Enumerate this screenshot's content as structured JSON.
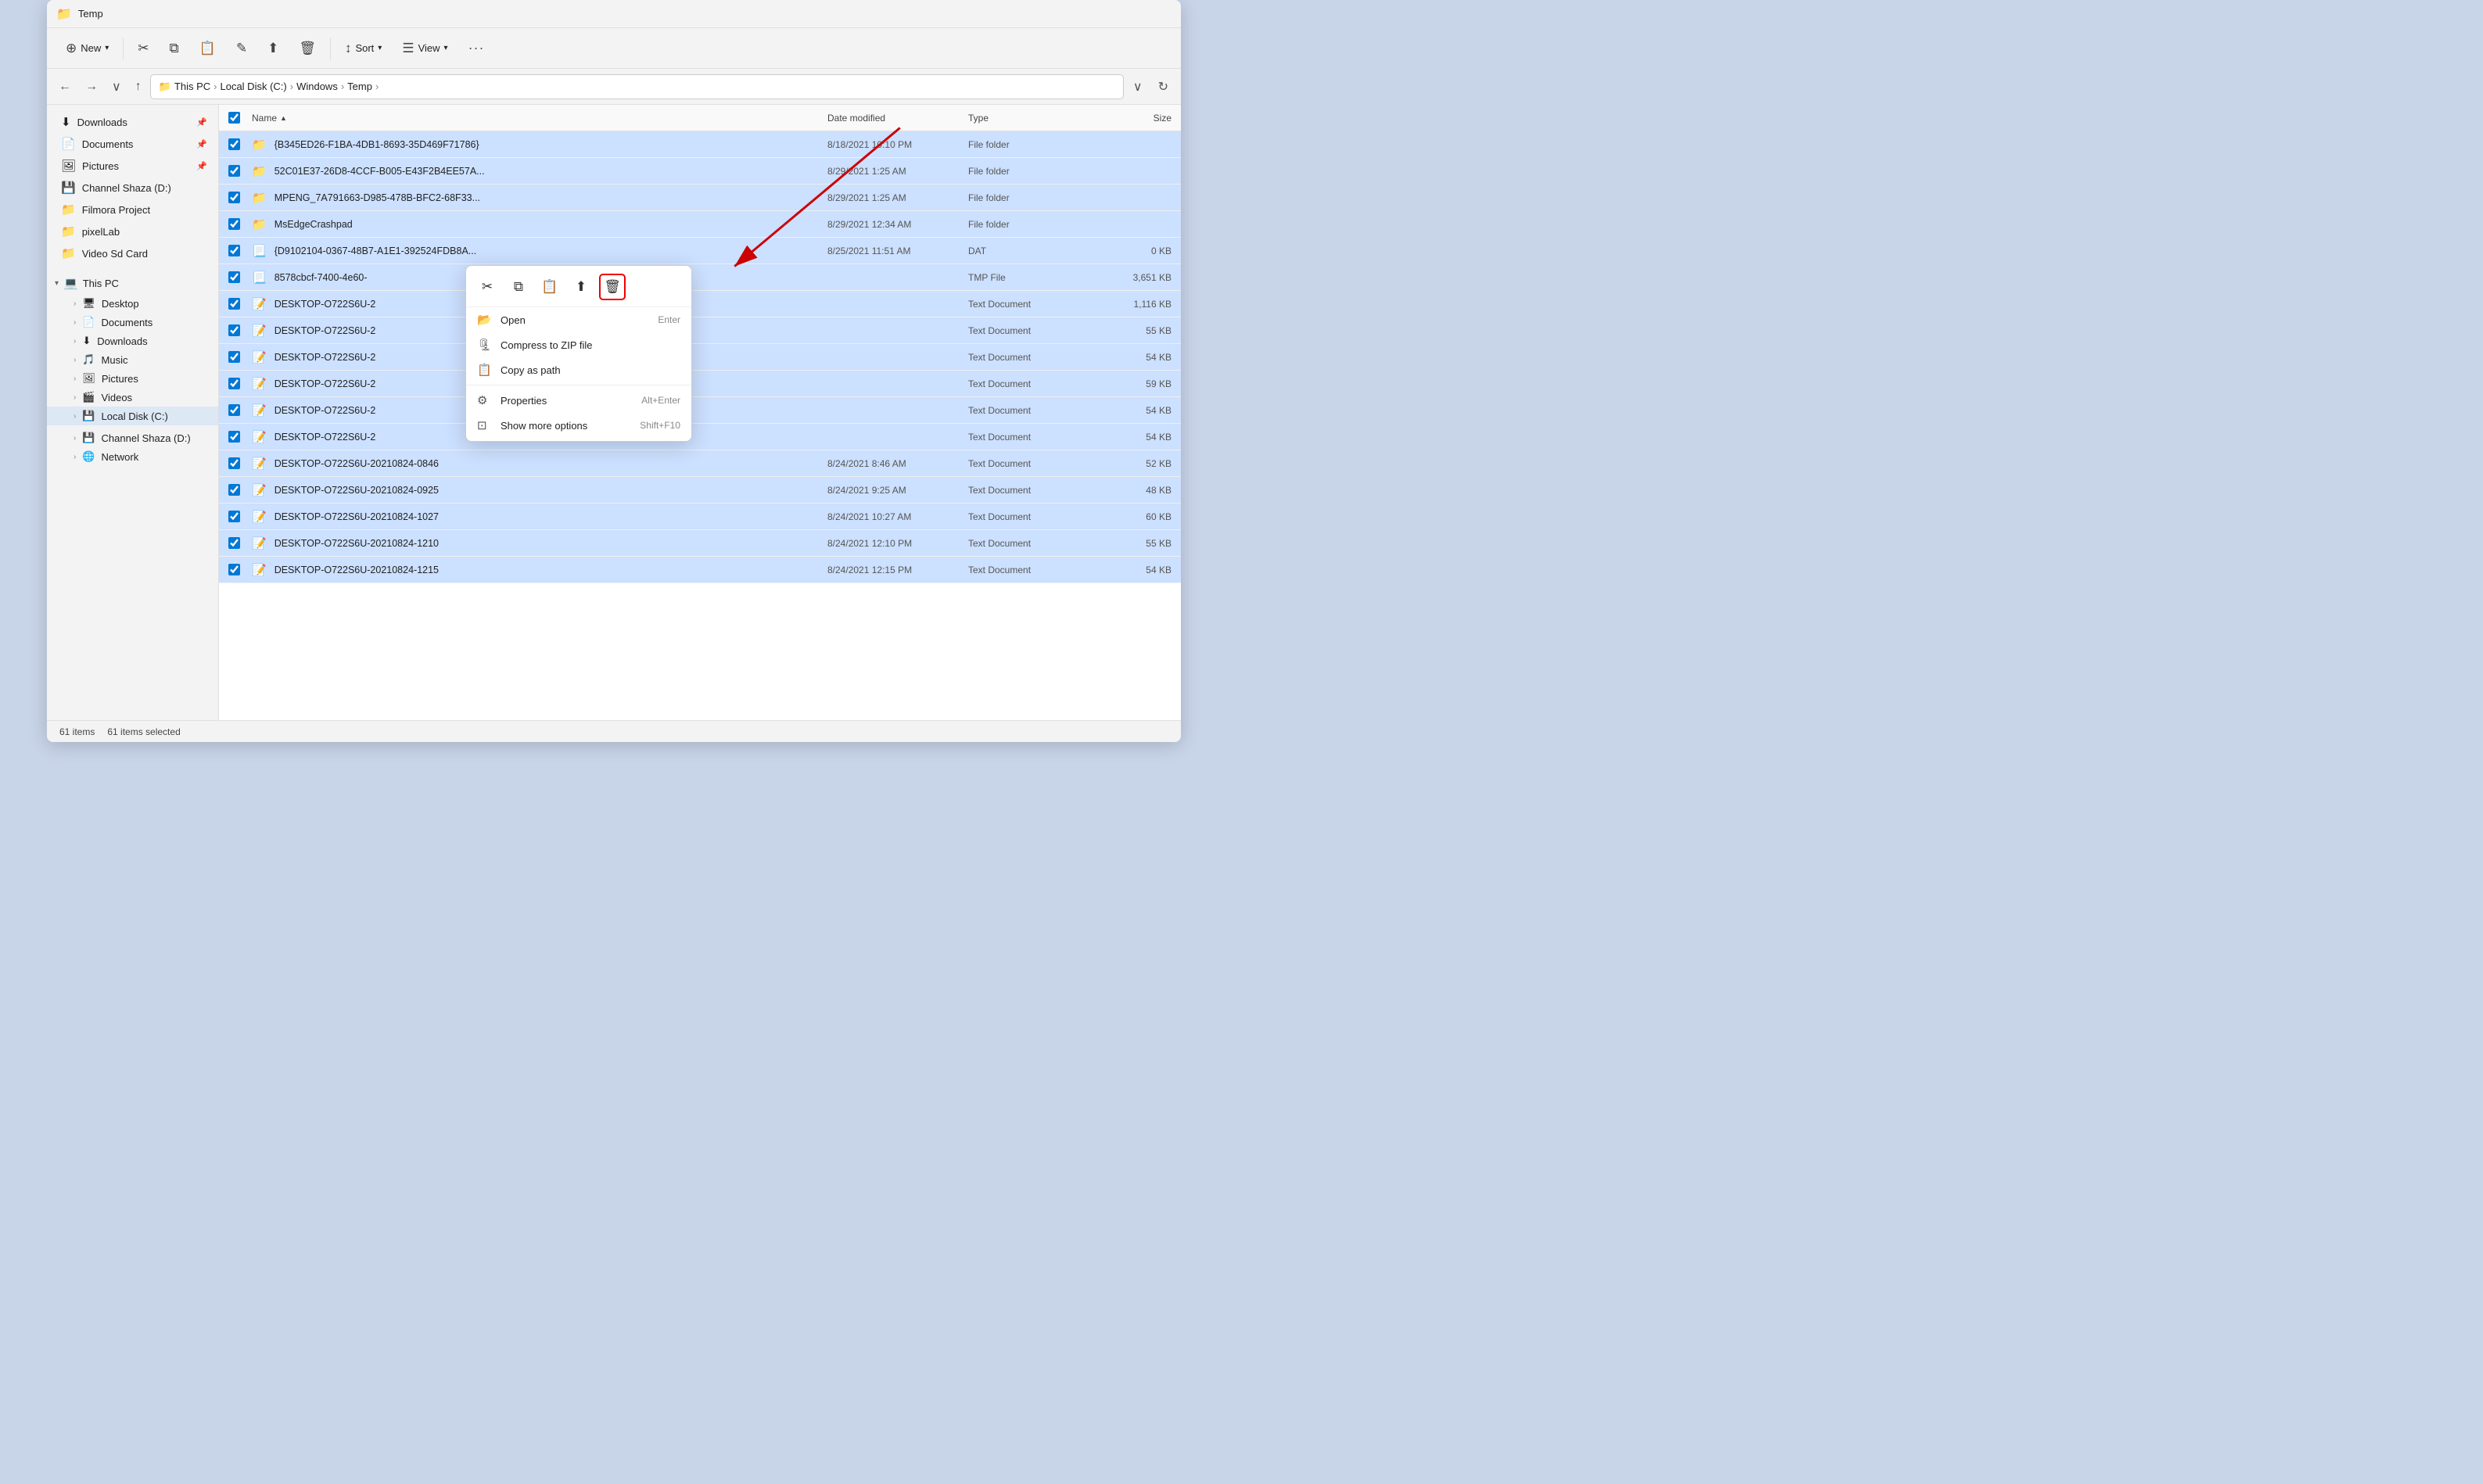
{
  "titleBar": {
    "icon": "📁",
    "title": "Temp"
  },
  "toolbar": {
    "new_label": "New",
    "cut_icon": "✂",
    "copy_icon": "⧉",
    "paste_icon": "📋",
    "rename_icon": "✎",
    "share_icon": "⬆",
    "delete_icon": "🗑",
    "sort_label": "Sort",
    "view_label": "View",
    "more_icon": "···"
  },
  "addressBar": {
    "path_parts": [
      "This PC",
      "Local Disk (C:)",
      "Windows",
      "Temp"
    ],
    "path_display": "This PC  ›  Local Disk (C:)  ›  Windows  ›  Temp  ›"
  },
  "sidebar": {
    "quick_access": [
      {
        "label": "Downloads",
        "icon": "⬇",
        "pinned": true
      },
      {
        "label": "Documents",
        "icon": "📄",
        "pinned": true
      },
      {
        "label": "Pictures",
        "icon": "🖼",
        "pinned": true
      },
      {
        "label": "Channel Shaza (D:)",
        "icon": "💾",
        "pinned": false
      },
      {
        "label": "Filmora Project",
        "icon": "📁",
        "pinned": false
      },
      {
        "label": "pixelLab",
        "icon": "📁",
        "pinned": false
      },
      {
        "label": "Video Sd Card",
        "icon": "📁",
        "pinned": false
      }
    ],
    "thisPC": {
      "label": "This PC",
      "children": [
        {
          "label": "Desktop",
          "icon": "🖥",
          "expanded": false
        },
        {
          "label": "Documents",
          "icon": "📄",
          "expanded": false
        },
        {
          "label": "Downloads",
          "icon": "⬇",
          "expanded": false
        },
        {
          "label": "Music",
          "icon": "🎵",
          "expanded": false
        },
        {
          "label": "Pictures",
          "icon": "🖼",
          "expanded": false
        },
        {
          "label": "Videos",
          "icon": "🎬",
          "expanded": false
        },
        {
          "label": "Local Disk (C:)",
          "icon": "💾",
          "expanded": false,
          "active": true
        }
      ]
    },
    "channelShaza": {
      "label": "Channel Shaza (D:)",
      "icon": "💾"
    },
    "network": {
      "label": "Network",
      "icon": "🌐"
    }
  },
  "fileList": {
    "columns": {
      "name": "Name",
      "date": "Date modified",
      "type": "Type",
      "size": "Size"
    },
    "rows": [
      {
        "name": "{B345ED26-F1BA-4DB1-8693-35D469F71786}",
        "date": "8/18/2021 10:10 PM",
        "type": "File folder",
        "size": "",
        "icon": "folder",
        "selected": true
      },
      {
        "name": "52C01E37-26D8-4CCF-B005-E43F2B4EE57A...",
        "date": "8/29/2021 1:25 AM",
        "type": "File folder",
        "size": "",
        "icon": "folder",
        "selected": true
      },
      {
        "name": "MPENG_7A791663-D985-478B-BFC2-68F33...",
        "date": "8/29/2021 1:25 AM",
        "type": "File folder",
        "size": "",
        "icon": "folder",
        "selected": true
      },
      {
        "name": "MsEdgeCrashpad",
        "date": "8/29/2021 12:34 AM",
        "type": "File folder",
        "size": "",
        "icon": "folder",
        "selected": true
      },
      {
        "name": "{D9102104-0367-48B7-A1E1-392524FDB8A...",
        "date": "8/25/2021 11:51 AM",
        "type": "DAT",
        "size": "0 KB",
        "icon": "dat",
        "selected": true
      },
      {
        "name": "8578cbcf-7400-4e60-",
        "date": "",
        "type": "TMP File",
        "size": "3,651 KB",
        "icon": "tmp",
        "selected": true
      },
      {
        "name": "DESKTOP-O722S6U-2",
        "date": "",
        "type": "Text Document",
        "size": "1,116 KB",
        "icon": "txt",
        "selected": true
      },
      {
        "name": "DESKTOP-O722S6U-2",
        "date": "",
        "type": "Text Document",
        "size": "55 KB",
        "icon": "txt",
        "selected": true
      },
      {
        "name": "DESKTOP-O722S6U-2",
        "date": "",
        "type": "Text Document",
        "size": "54 KB",
        "icon": "txt",
        "selected": true
      },
      {
        "name": "DESKTOP-O722S6U-2",
        "date": "",
        "type": "Text Document",
        "size": "59 KB",
        "icon": "txt",
        "selected": true
      },
      {
        "name": "DESKTOP-O722S6U-2",
        "date": "",
        "type": "Text Document",
        "size": "54 KB",
        "icon": "txt",
        "selected": true
      },
      {
        "name": "DESKTOP-O722S6U-2",
        "date": "",
        "type": "Text Document",
        "size": "54 KB",
        "icon": "txt",
        "selected": true
      },
      {
        "name": "DESKTOP-O722S6U-20210824-0846",
        "date": "8/24/2021 8:46 AM",
        "type": "Text Document",
        "size": "52 KB",
        "icon": "txt",
        "selected": true
      },
      {
        "name": "DESKTOP-O722S6U-20210824-0925",
        "date": "8/24/2021 9:25 AM",
        "type": "Text Document",
        "size": "48 KB",
        "icon": "txt",
        "selected": true
      },
      {
        "name": "DESKTOP-O722S6U-20210824-1027",
        "date": "8/24/2021 10:27 AM",
        "type": "Text Document",
        "size": "60 KB",
        "icon": "txt",
        "selected": true
      },
      {
        "name": "DESKTOP-O722S6U-20210824-1210",
        "date": "8/24/2021 12:10 PM",
        "type": "Text Document",
        "size": "55 KB",
        "icon": "txt",
        "selected": true
      },
      {
        "name": "DESKTOP-O722S6U-20210824-1215",
        "date": "8/24/2021 12:15 PM",
        "type": "Text Document",
        "size": "54 KB",
        "icon": "txt",
        "selected": true
      }
    ]
  },
  "contextMenu": {
    "miniToolbar": {
      "cut": "✂",
      "copy": "⧉",
      "paste": "📋",
      "share": "⬆",
      "delete": "🗑"
    },
    "items": [
      {
        "label": "Open",
        "icon": "📂",
        "shortcut": "Enter"
      },
      {
        "label": "Compress to ZIP file",
        "icon": "🗜",
        "shortcut": ""
      },
      {
        "label": "Copy as path",
        "icon": "📋",
        "shortcut": ""
      },
      {
        "label": "Properties",
        "icon": "⚙",
        "shortcut": "Alt+Enter"
      },
      {
        "label": "Show more options",
        "icon": "⋯",
        "shortcut": "Shift+F10"
      }
    ]
  },
  "statusBar": {
    "items": "61 items",
    "selected": "61 items selected"
  }
}
